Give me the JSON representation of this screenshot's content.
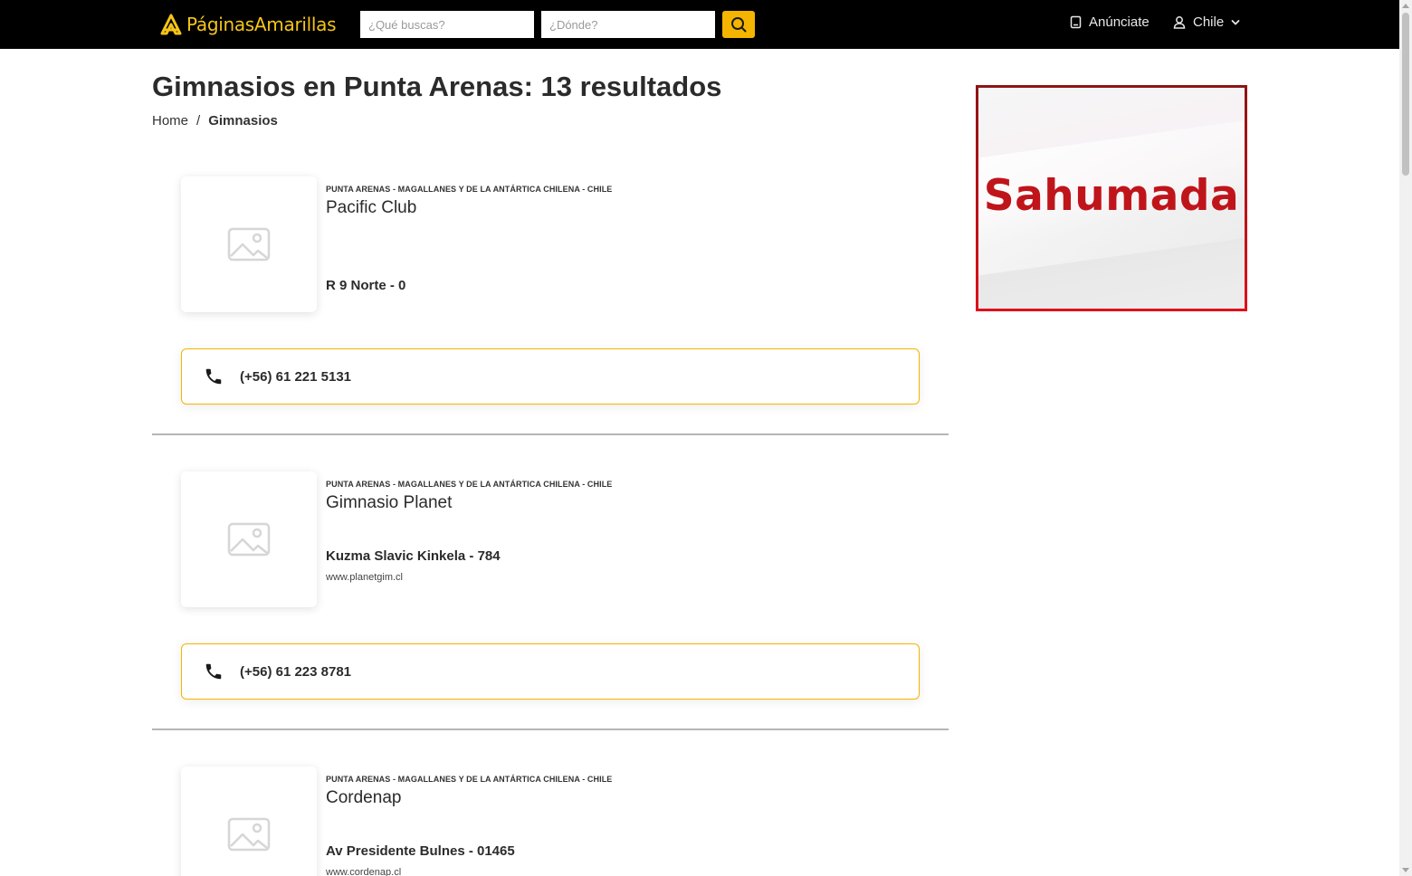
{
  "navbar": {
    "logo_text": "PáginasAmarillas",
    "search_what_placeholder": "¿Qué buscas?",
    "search_where_placeholder": "¿Dónde?",
    "advertise_label": "Anúnciate",
    "country_label": "Chile",
    "accent_color": "#f5b400"
  },
  "header": {
    "title_strong": "Gimnasios en Punta Arenas",
    "title_rest": ": 13 resultados",
    "breadcrumb": {
      "home": "Home",
      "separator": "/",
      "current": "Gimnasios"
    }
  },
  "listings": [
    {
      "region": "PUNTA ARENAS - MAGALLANES Y DE LA ANTÁRTICA CHILENA - CHILE",
      "name": "Pacific Club",
      "address": "R 9 Norte - 0",
      "website": "",
      "phone": "(+56) 61 221 5131"
    },
    {
      "region": "PUNTA ARENAS - MAGALLANES Y DE LA ANTÁRTICA CHILENA - CHILE",
      "name": "Gimnasio Planet",
      "address": "Kuzma Slavic Kinkela - 784",
      "website": "www.planetgim.cl",
      "phone": "(+56) 61 223 8781"
    },
    {
      "region": "PUNTA ARENAS - MAGALLANES Y DE LA ANTÁRTICA CHILENA - CHILE",
      "name": "Cordenap",
      "address": "Av Presidente Bulnes - 01465",
      "website": "www.cordenap.cl",
      "phone": ""
    }
  ],
  "ad": {
    "text": "Sahumada",
    "color": "#c0141b"
  },
  "icons": {
    "image_placeholder": "image-placeholder-icon",
    "phone": "phone-icon",
    "search": "search-icon",
    "advertise": "document-icon",
    "user": "user-icon",
    "chevron": "chevron-down-icon"
  }
}
